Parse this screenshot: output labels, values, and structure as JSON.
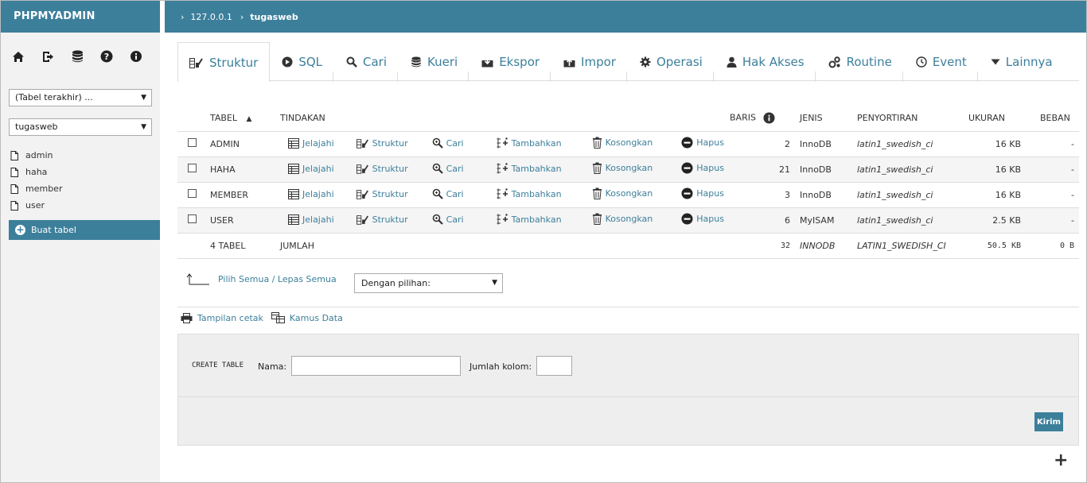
{
  "sidebar": {
    "logo": "PHPMYADMIN",
    "nav_icons": [
      "home-icon",
      "logout-icon",
      "database-icon",
      "help-icon",
      "info-icon"
    ],
    "recent_select": "(Tabel terakhir) ...",
    "db_select": "tugasweb",
    "tables": [
      {
        "name": "admin"
      },
      {
        "name": "haha"
      },
      {
        "name": "member"
      },
      {
        "name": "user"
      }
    ],
    "new_table": "Buat tabel"
  },
  "breadcrumb": {
    "server": "127.0.0.1",
    "database": "tugasweb"
  },
  "tabs": [
    {
      "label": "Struktur",
      "icon": "structure-icon",
      "active": true
    },
    {
      "label": "SQL",
      "icon": "sql-icon"
    },
    {
      "label": "Cari",
      "icon": "search-icon"
    },
    {
      "label": "Kueri",
      "icon": "query-icon"
    },
    {
      "label": "Ekspor",
      "icon": "export-icon"
    },
    {
      "label": "Impor",
      "icon": "import-icon"
    },
    {
      "label": "Operasi",
      "icon": "gear-icon"
    },
    {
      "label": "Hak Akses",
      "icon": "user-icon"
    },
    {
      "label": "Routine",
      "icon": "routine-icon"
    },
    {
      "label": "Event",
      "icon": "clock-icon"
    },
    {
      "label": "Lainnya",
      "icon": "chevron-down-icon"
    }
  ],
  "table_headers": {
    "tabel": "TABEL",
    "tindakan": "TINDAKAN",
    "baris": "BARIS",
    "jenis": "JENIS",
    "penyortiran": "PENYORTIRAN",
    "ukuran": "UKURAN",
    "beban": "BEBAN"
  },
  "actions": {
    "browse": "Jelajahi",
    "structure": "Struktur",
    "search": "Cari",
    "insert": "Tambahkan",
    "empty": "Kosongkan",
    "drop": "Hapus"
  },
  "rows": [
    {
      "name": "ADMIN",
      "rows": "2",
      "engine": "InnoDB",
      "collation": "latin1_swedish_ci",
      "size": "16 KB",
      "overhead": "-"
    },
    {
      "name": "HAHA",
      "rows": "21",
      "engine": "InnoDB",
      "collation": "latin1_swedish_ci",
      "size": "16 KB",
      "overhead": "-"
    },
    {
      "name": "MEMBER",
      "rows": "3",
      "engine": "InnoDB",
      "collation": "latin1_swedish_ci",
      "size": "16 KB",
      "overhead": "-"
    },
    {
      "name": "USER",
      "rows": "6",
      "engine": "MyISAM",
      "collation": "latin1_swedish_ci",
      "size": "2.5 KB",
      "overhead": "-"
    }
  ],
  "summary": {
    "count": "4 TABEL",
    "label": "JUMLAH",
    "rows": "32",
    "engine": "INNODB",
    "collation": "LATIN1_SWEDISH_CI",
    "size": "50.5 KB",
    "overhead": "0 B"
  },
  "check_all": "Pilih Semua / Lepas Semua",
  "with_selected": "Dengan pilihan:",
  "print_view": "Tampilan cetak",
  "data_dictionary": "Kamus Data",
  "create_table": {
    "legend": "CREATE TABLE",
    "name_label": "Nama:",
    "name_value": "",
    "columns_label": "Jumlah kolom:",
    "columns_value": "",
    "submit": "Kirim"
  },
  "expand_symbol": "+",
  "colors": {
    "primary": "#3c7f9b",
    "sidebar_bg": "#f2f2f2",
    "alt_row": "#f5f5f5"
  }
}
